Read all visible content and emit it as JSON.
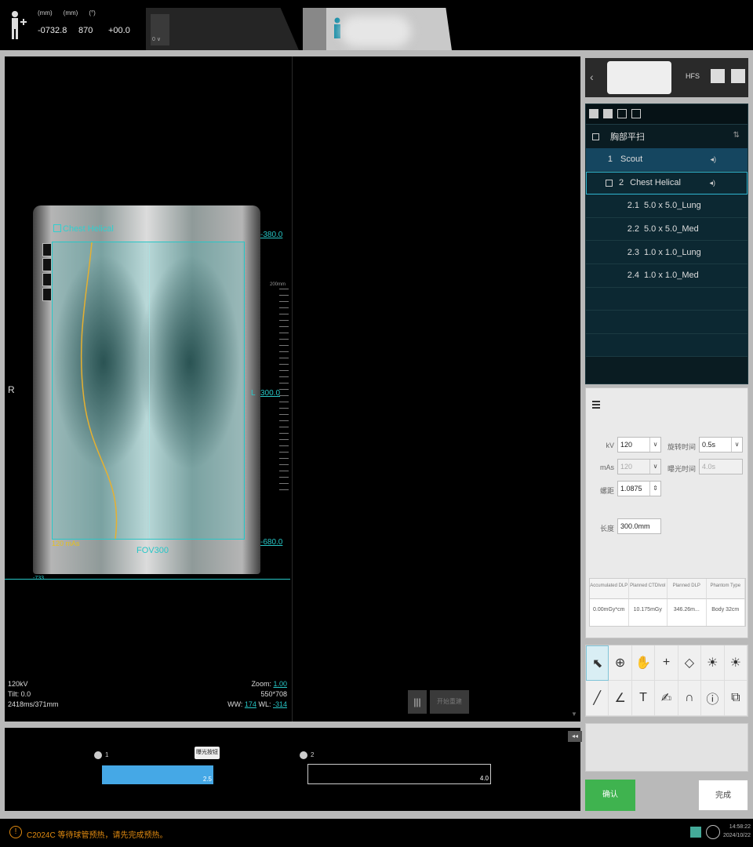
{
  "topbar": {
    "coords": {
      "head1": "(mm)",
      "head2": "(mm)",
      "head3": "(°)",
      "val1": "-0732.8",
      "val2": "870",
      "val3": "+00.0"
    },
    "tab1_label": "0 ∨"
  },
  "viewer": {
    "scan_title": "Chest Helical",
    "pos_top": "-380.0",
    "pos_mid": "300.0",
    "pos_bottom": "-680.0",
    "pos_mid_prefix": "L",
    "ruler_label": "200mm",
    "dose_tag": "120 mAs",
    "fov_tag": "FOV300",
    "table_label": "-733",
    "orientation": "R",
    "info_left": [
      "120kV",
      "Tilt: 0.0",
      "2418ms/371mm"
    ],
    "zoom_label": "Zoom:",
    "zoom_value": "1.00",
    "image_index": "550*708",
    "ww_label": "WW:",
    "ww_value": "174",
    "wl_label": "WL:",
    "wl_value": "-314",
    "layout_icon": "|||",
    "gray_button": "开始重建"
  },
  "timeline": {
    "collapse": "◂◂",
    "step1": "1",
    "step2": "2",
    "bar1_value": "2.5",
    "bar2_value": "4.0",
    "tooltip": "曝光按钮"
  },
  "right_top": {
    "back": "‹",
    "position": "HFS"
  },
  "protocol": {
    "header": "胸部平扫",
    "rows": [
      {
        "num": "1",
        "name": "Scout"
      },
      {
        "num": "2",
        "name": "Chest Helical"
      }
    ],
    "recons": [
      {
        "num": "2.1",
        "name": "5.0 x 5.0_Lung"
      },
      {
        "num": "2.2",
        "name": "5.0 x 5.0_Med"
      },
      {
        "num": "2.3",
        "name": "1.0 x 1.0_Lung"
      },
      {
        "num": "2.4",
        "name": "1.0 x 1.0_Med"
      }
    ]
  },
  "params": {
    "kv_label": "kV",
    "kv_value": "120",
    "mas_label": "mAs",
    "mas_value": "120",
    "pitch_label": "螺距",
    "pitch_value": "1.0875",
    "rot_label": "旋转时间",
    "rot_value": "0.5s",
    "exp_label": "曝光时间",
    "exp_value": "4.0s",
    "len_label": "长度",
    "len_value": "300.0mm",
    "dose_headers": [
      "Accumulated DLP",
      "Planned CTDIvol",
      "Planned DLP",
      "Phantom Type"
    ],
    "dose_values": [
      "0.00mGy*cm",
      "10.175mGy",
      "346.26m...",
      "Body 32cm"
    ]
  },
  "tools": [
    "⬉",
    "⊕",
    "✋",
    "+",
    "◇",
    "☀",
    "☀",
    "╱",
    "∠",
    "T",
    "✍",
    "∩",
    "ⓘ",
    "⧉"
  ],
  "buttons": {
    "confirm": "确认",
    "done": "完成"
  },
  "status": {
    "warn_icon": "!",
    "warning": "C2024C  等待球管预热，请先完成预热。",
    "time": "14:58:22",
    "date": "2024/10/22"
  }
}
